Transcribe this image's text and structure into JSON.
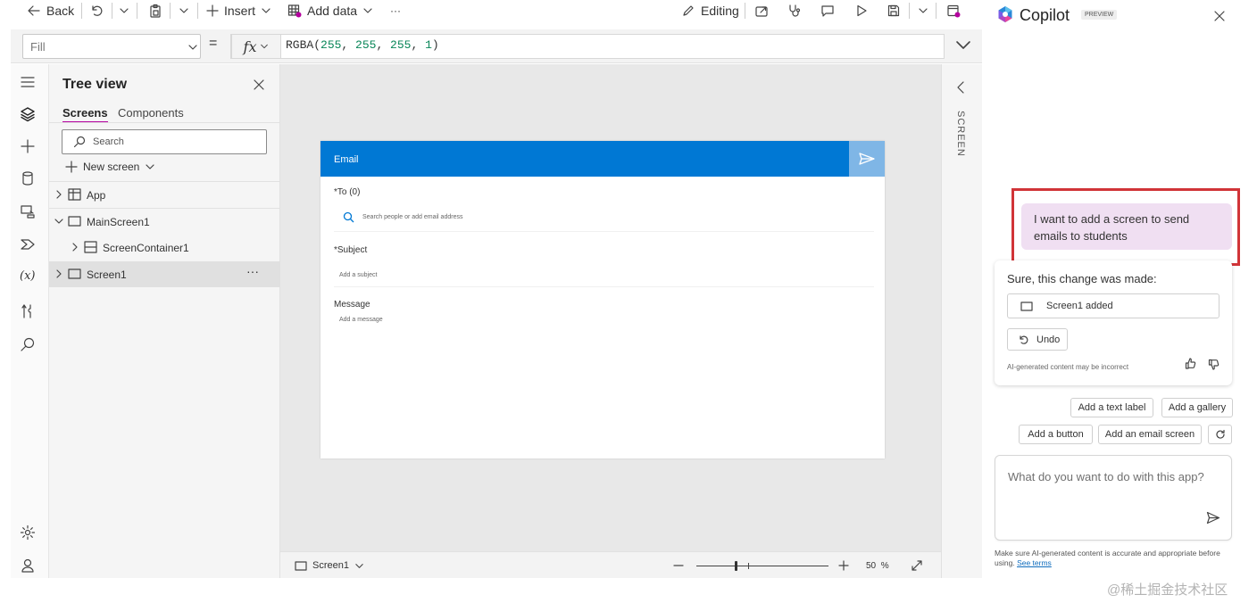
{
  "toolbar": {
    "back_label": "Back",
    "insert_label": "Insert",
    "add_data_label": "Add data",
    "more_label": "···",
    "editing_label": "Editing"
  },
  "formula": {
    "property": "Fill",
    "equals": "=",
    "fx": "fx",
    "func": "RGBA(",
    "args": [
      "255",
      "255",
      "255",
      "1"
    ],
    "close": ")"
  },
  "tree": {
    "title": "Tree view",
    "tabs": [
      "Screens",
      "Components"
    ],
    "search_placeholder": "Search",
    "new_screen_label": "New screen",
    "items": [
      {
        "label": "App"
      },
      {
        "label": "MainScreen1"
      },
      {
        "label": "ScreenContainer1"
      },
      {
        "label": "Screen1"
      }
    ],
    "more": "···"
  },
  "email_screen": {
    "header": "Email",
    "to_label": "*To (0)",
    "to_placeholder": "Search people or add email address",
    "subject_label": "*Subject",
    "subject_placeholder": "Add a subject",
    "message_label": "Message",
    "message_placeholder": "Add a message"
  },
  "statusbar": {
    "screen_label": "Screen1",
    "zoom_value": "50",
    "zoom_unit": "%",
    "zoom_fraction": 0.3
  },
  "right_strip": {
    "label": "SCREEN"
  },
  "copilot": {
    "title": "Copilot",
    "badge": "PREVIEW",
    "user_message": "I want to add a screen to send emails to students",
    "response_title": "Sure, this change was made:",
    "change_item": "Screen1 added",
    "undo_label": "Undo",
    "disclaimer": "AI-generated content may be incorrect",
    "suggestions": [
      "Add a text label",
      "Add a gallery",
      "Add a button",
      "Add an email screen"
    ],
    "input_placeholder": "What do you want to do with this app?",
    "footer_text": "Make sure AI-generated content is accurate and appropriate before using.",
    "footer_link": "See terms",
    "highlight_color": "#d13438",
    "bubble_color": "#f0dff2"
  },
  "watermark": "@稀土掘金技术社区",
  "colors": {
    "accent": "#0078d4",
    "send_disabled": "#7fb6e6"
  }
}
